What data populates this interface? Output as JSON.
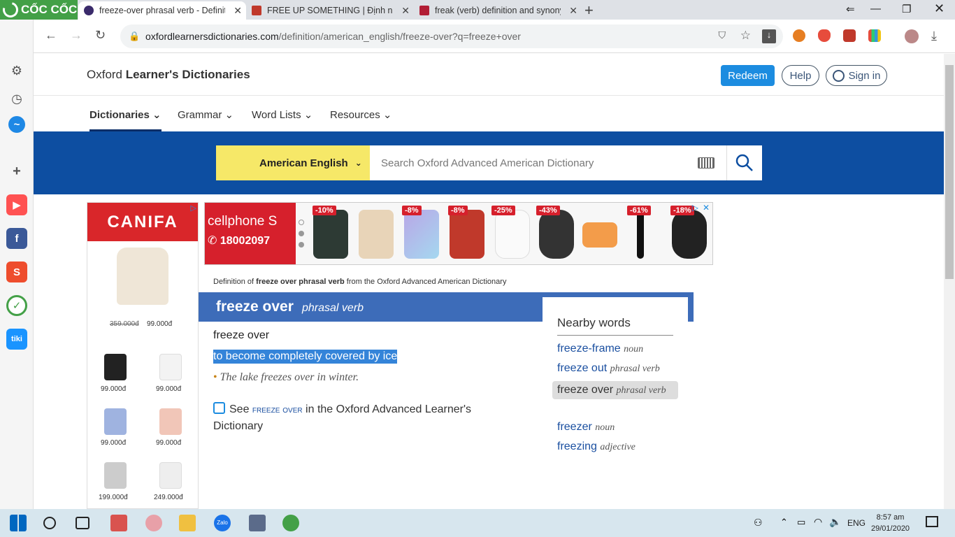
{
  "browser": {
    "brand": "CỐC CỐC",
    "tabs": [
      {
        "title": "freeze-over phrasal verb - Definitio",
        "active": true
      },
      {
        "title": "FREE UP SOMETHING | Định nghĩa",
        "active": false
      },
      {
        "title": "freak (verb) definition and synony",
        "active": false
      }
    ],
    "url_host": "oxfordlearnersdictionaries.com",
    "url_path": "/definition/american_english/freeze-over?q=freeze+over"
  },
  "site": {
    "logo_plain": "Oxford ",
    "logo_bold": "Learner's Dictionaries",
    "redeem": "Redeem",
    "help": "Help",
    "signin": "Sign in",
    "nav": [
      "Dictionaries",
      "Grammar",
      "Word Lists",
      "Resources"
    ],
    "dict_selector": "American English",
    "search_placeholder": "Search Oxford Advanced American Dictionary"
  },
  "ads": {
    "canifa": {
      "brand": "CANIFA",
      "old_price": "359.000đ",
      "price": "99.000đ",
      "prices": [
        "99.000đ",
        "99.000đ",
        "99.000đ",
        "99.000đ",
        "199.000đ",
        "249.000đ"
      ]
    },
    "cellphones": {
      "name": "cellphone S",
      "phone": "18002097",
      "discounts": [
        "-10%",
        "-8%",
        "-8%",
        "-25%",
        "-43%",
        "-61%",
        "-18%"
      ]
    }
  },
  "entry": {
    "definition_of_prefix": "Definition of ",
    "definition_of_bold": "freeze over phrasal verb",
    "definition_of_suffix": " from the Oxford Advanced American Dictionary",
    "headword": "freeze over",
    "pos": "phrasal verb",
    "sense_headword": "freeze over",
    "definition": "to become completely covered by ice",
    "example": "The lake freezes over in winter.",
    "see_prefix": "See ",
    "see_link": "freeze over",
    "see_suffix": " in the Oxford Advanced Learner's Dictionary"
  },
  "nearby": {
    "title": "Nearby words",
    "items": [
      {
        "word": "freeze-frame",
        "pos": "noun"
      },
      {
        "word": "freeze out",
        "pos": "phrasal verb"
      },
      {
        "word": "freeze over",
        "pos": "phrasal verb"
      },
      {
        "word": "freezer",
        "pos": "noun"
      },
      {
        "word": "freezing",
        "pos": "adjective"
      }
    ]
  },
  "taskbar": {
    "lang": "ENG",
    "time": "8:57 am",
    "date": "29/01/2020"
  }
}
